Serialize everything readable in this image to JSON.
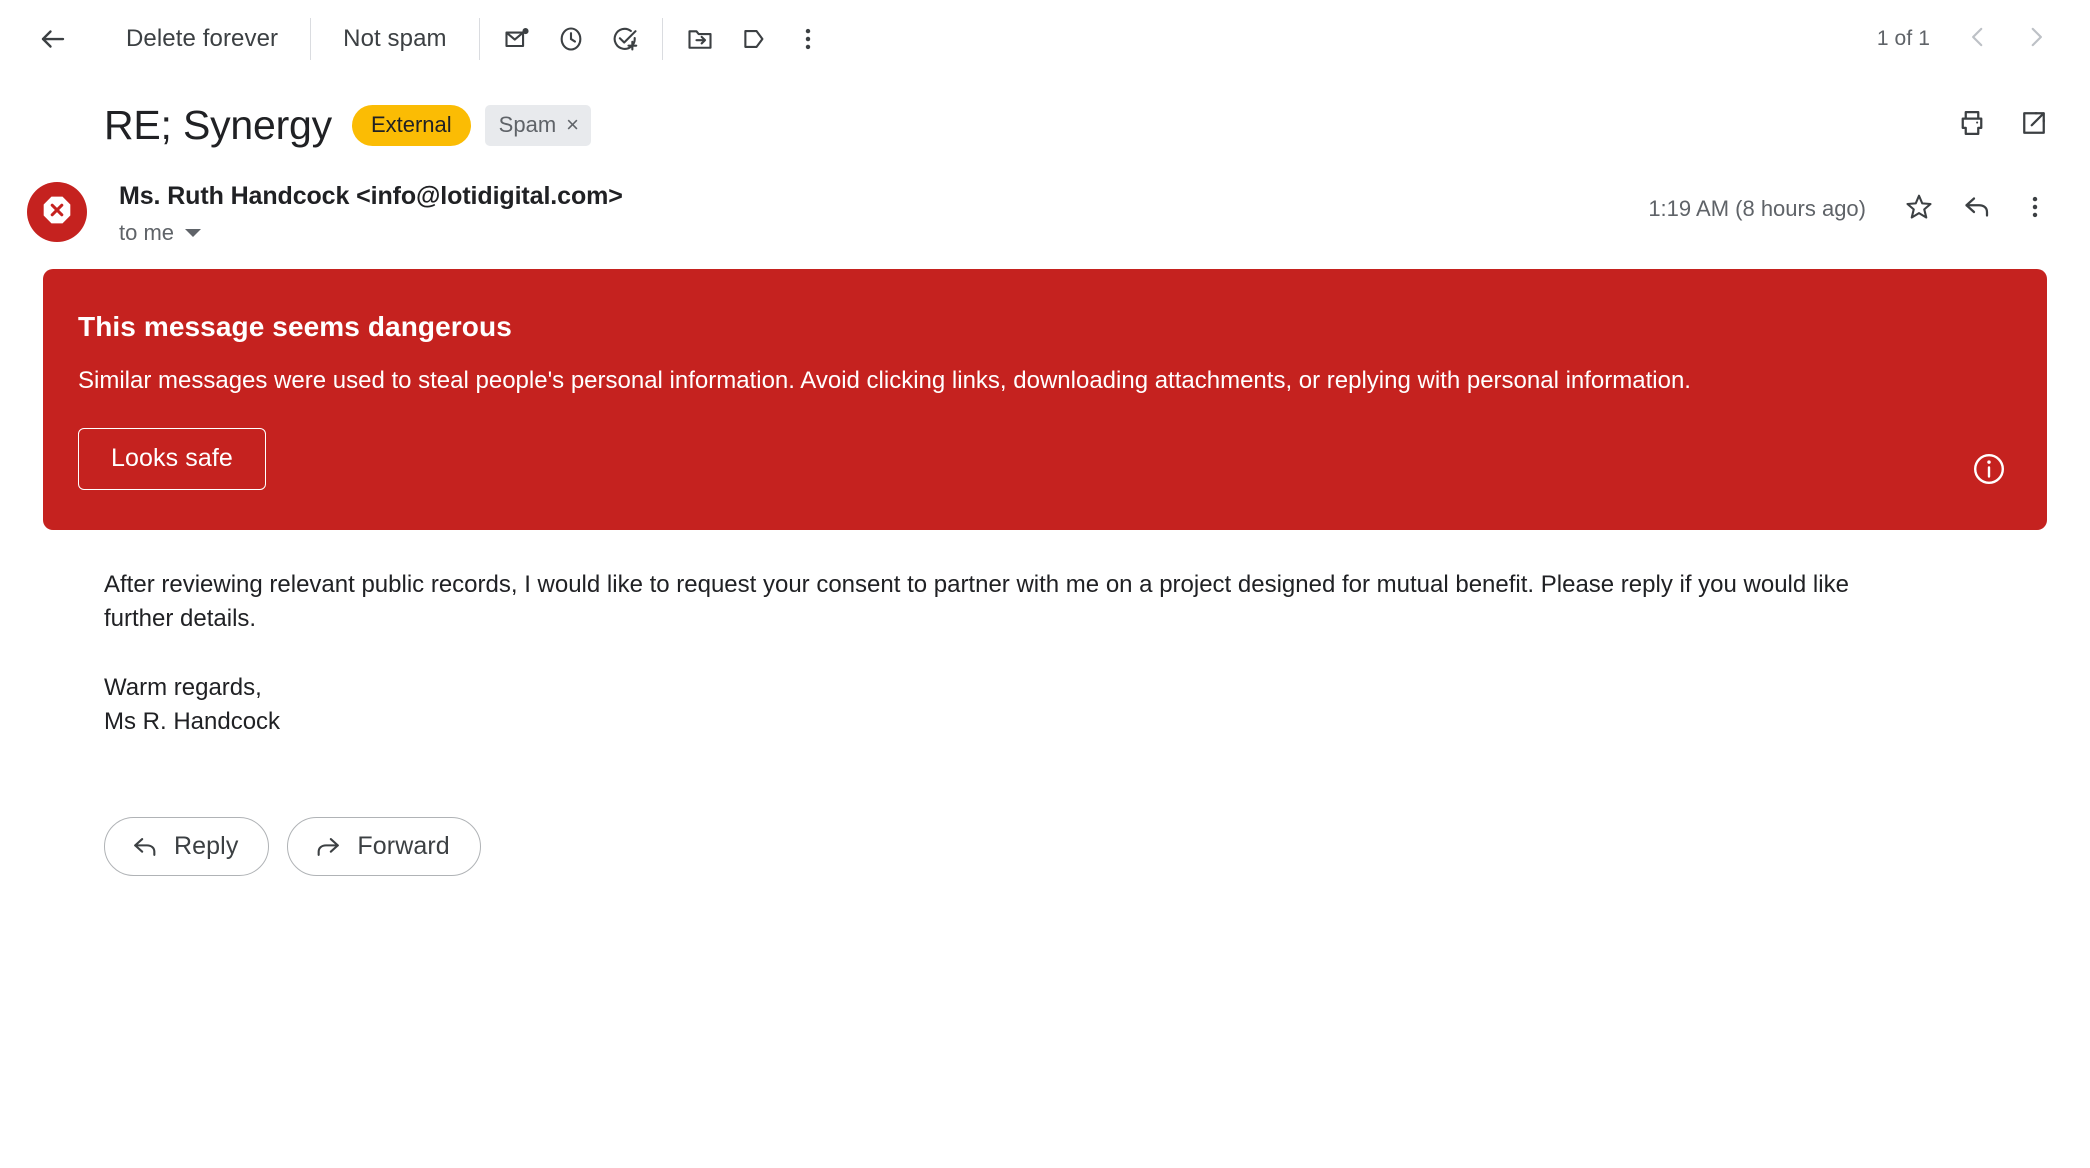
{
  "toolbar": {
    "back_label": "back-arrow",
    "delete_forever_label": "Delete forever",
    "not_spam_label": "Not spam",
    "icons": [
      {
        "name": "mark-as-unread-icon",
        "title": "Mark as unread"
      },
      {
        "name": "snooze-clock-icon",
        "title": "Snooze"
      },
      {
        "name": "add-to-tasks-icon",
        "title": "Add to tasks"
      },
      {
        "name": "move-to-folder-icon",
        "title": "Move to"
      },
      {
        "name": "label-tag-icon",
        "title": "Labels"
      },
      {
        "name": "more-options-icon",
        "title": "More"
      }
    ],
    "pager_count": "1 of 1",
    "prev_title": "Newer",
    "next_title": "Older"
  },
  "subject": {
    "title": "RE; Synergy",
    "external_pill": "External",
    "spam_chip": "Spam",
    "spam_chip_remove": "×",
    "print_title": "Print all",
    "popout_title": "In new window"
  },
  "sender": {
    "avatar_icon": "dangerous-octagon-icon",
    "name_and_email": "Ms. Ruth Handcock <info@lotidigital.com>",
    "recipient": "to me",
    "timestamp": "1:19 AM (8 hours ago)",
    "star_title": "Not starred",
    "reply_title": "Reply",
    "more_title": "More"
  },
  "banner": {
    "title": "This message seems dangerous",
    "body": "Similar messages were used to steal people's personal information. Avoid clicking links, downloading attachments, or replying with personal information.",
    "button_label": "Looks safe",
    "info_title": "More info",
    "background_color": "#C5221F",
    "text_color": "#FFFFFF"
  },
  "message": {
    "paragraph_1": "After reviewing relevant public records, I would like to request your consent to partner with me on a project designed for mutual benefit. Please reply if you would like further details.",
    "signoff": "Warm regards,",
    "signature": "Ms R. Handcock"
  },
  "actions": {
    "reply_label": "Reply",
    "forward_label": "Forward"
  },
  "colors": {
    "danger_red": "#C5221F",
    "external_amber": "#FBBC04",
    "chip_gray": "#E8EAED",
    "text_primary": "#202124",
    "text_secondary": "#5F6368"
  }
}
